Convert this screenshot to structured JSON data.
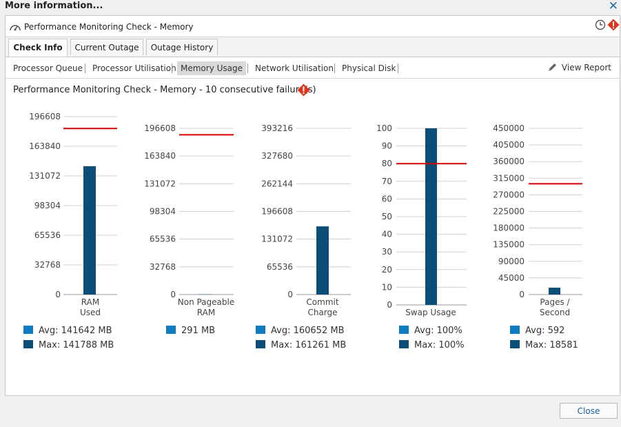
{
  "window": {
    "title": "More information...",
    "close_glyph": "✕"
  },
  "header": {
    "title": "Performance Monitoring Check - Memory",
    "icons": [
      "gauge-icon",
      "clock-icon",
      "warning-icon"
    ]
  },
  "tabs": [
    {
      "label": "Check Info",
      "active": true
    },
    {
      "label": "Current Outage",
      "active": false
    },
    {
      "label": "Outage History",
      "active": false
    }
  ],
  "subtabs": [
    {
      "label": "Processor Queue",
      "selected": false
    },
    {
      "label": "Processor Utilisation",
      "selected": false
    },
    {
      "label": "Memory Usage",
      "selected": true
    },
    {
      "label": "Network Utilisation",
      "selected": false
    },
    {
      "label": "Physical Disk",
      "selected": false
    }
  ],
  "view_report": "View Report",
  "heading": "Performance Monitoring Check - Memory - 10 consecutive failure(s)",
  "colors": {
    "bar": "#0b4f79",
    "threshold": "#d40000",
    "avg": "#0f7bc0",
    "max": "#0b4f79",
    "grid": "#d0d0d0"
  },
  "chart_data": [
    {
      "type": "bar",
      "category": "RAM Used",
      "label_lines": [
        "RAM",
        "Used"
      ],
      "ticks": [
        "196608",
        "163840",
        "131072",
        "98304",
        "65536",
        "32768",
        "0"
      ],
      "ylim": [
        0,
        196608
      ],
      "value": 141788,
      "threshold": 183500,
      "legend": [
        {
          "kind": "avg",
          "text": "Avg: 141642 MB"
        },
        {
          "kind": "max",
          "text": "Max: 141788 MB"
        }
      ]
    },
    {
      "type": "bar",
      "category": "Non Pageable RAM",
      "label_lines": [
        "Non Pageable",
        "RAM"
      ],
      "ticks": [
        "196608",
        "163840",
        "131072",
        "98304",
        "65536",
        "32768",
        "0"
      ],
      "ylim": [
        0,
        196608
      ],
      "value": 291,
      "threshold": 189000,
      "legend": [
        {
          "kind": "avg",
          "text": "291 MB"
        }
      ]
    },
    {
      "type": "bar",
      "category": "Commit Charge",
      "label_lines": [
        "Commit",
        "Charge"
      ],
      "ticks": [
        "393216",
        "327680",
        "262144",
        "196608",
        "131072",
        "65536",
        "0"
      ],
      "ylim": [
        0,
        393216
      ],
      "value": 161261,
      "threshold": null,
      "legend": [
        {
          "kind": "avg",
          "text": "Avg: 160652 MB"
        },
        {
          "kind": "max",
          "text": "Max: 161261 MB"
        }
      ]
    },
    {
      "type": "bar",
      "category": "Swap Usage",
      "label_lines": [
        "Swap Usage"
      ],
      "ticks": [
        "100",
        "90",
        "80",
        "70",
        "60",
        "50",
        "40",
        "30",
        "20",
        "10",
        "0"
      ],
      "ylim": [
        0,
        100
      ],
      "value": 100,
      "threshold": 80,
      "legend": [
        {
          "kind": "avg",
          "text": "Avg: 100%"
        },
        {
          "kind": "max",
          "text": "Max: 100%"
        }
      ]
    },
    {
      "type": "bar",
      "category": "Pages / Second",
      "label_lines": [
        "Pages /",
        "Second"
      ],
      "ticks": [
        "450000",
        "405000",
        "360000",
        "315000",
        "270000",
        "225000",
        "180000",
        "135000",
        "90000",
        "45000",
        "0"
      ],
      "ylim": [
        0,
        450000
      ],
      "value": 18581,
      "threshold": 300000,
      "legend": [
        {
          "kind": "avg",
          "text": "Avg: 592"
        },
        {
          "kind": "max",
          "text": "Max: 18581"
        }
      ]
    }
  ],
  "close_button": "Close"
}
